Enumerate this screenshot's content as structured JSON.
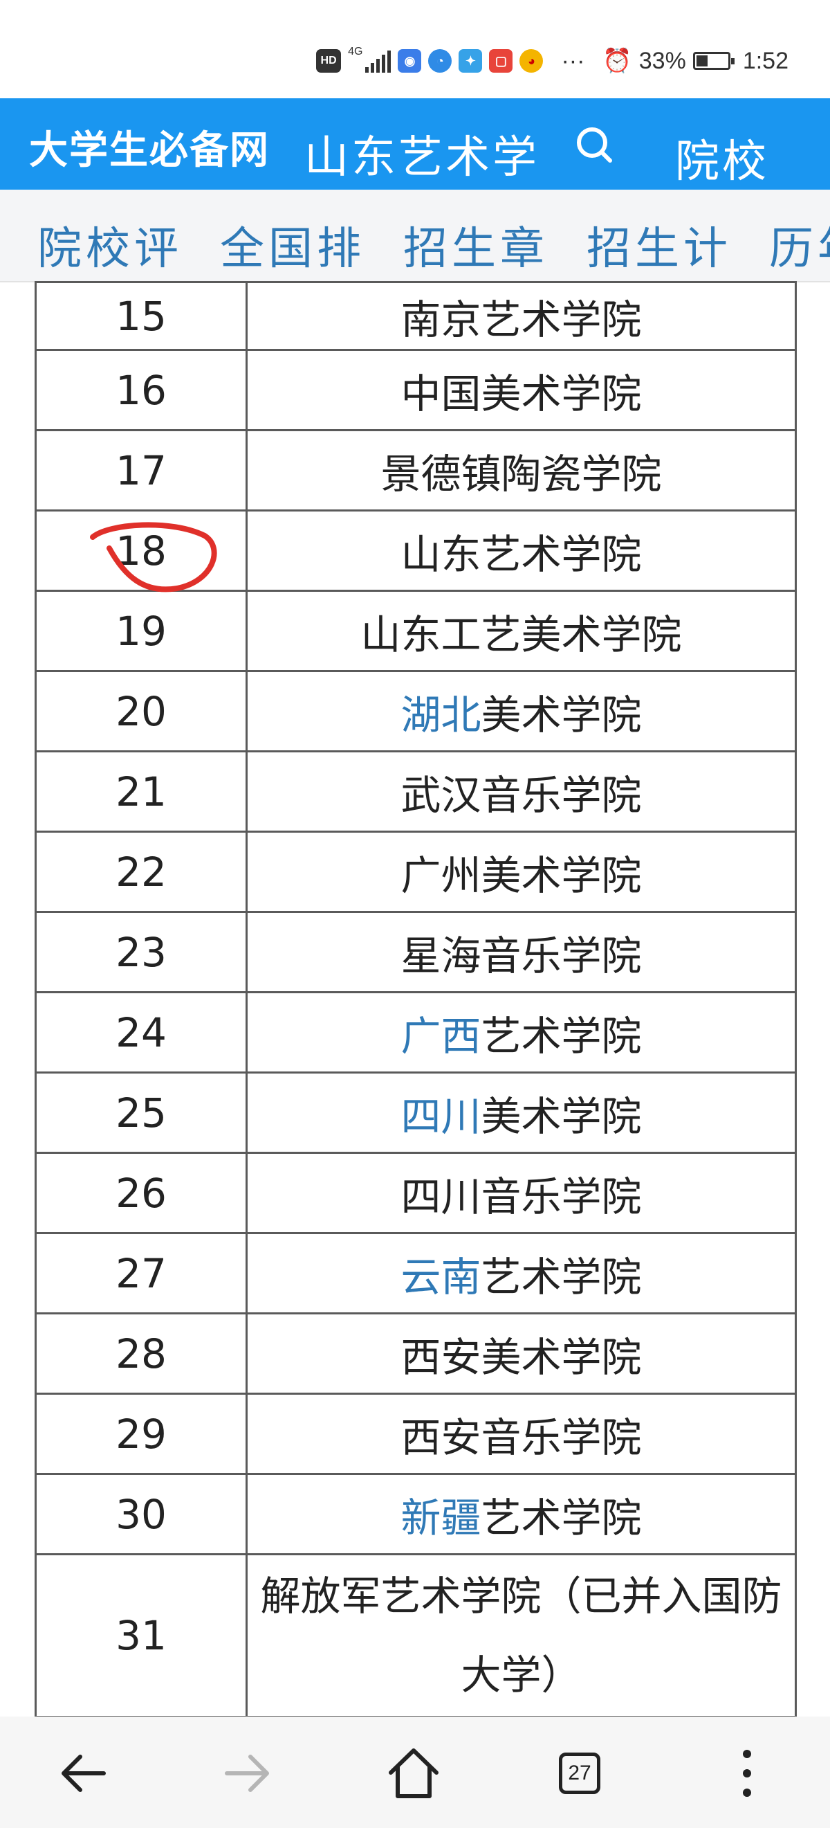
{
  "status_bar": {
    "hd": "HD",
    "network": "4G",
    "icons": [
      "wifi-icon",
      "browser-icon",
      "app-icon",
      "notes-icon",
      "weibo-icon"
    ],
    "more": "···",
    "alarm_icon": "alarm-icon",
    "battery_percent": "33%",
    "time": "1:52"
  },
  "header": {
    "logo": "大学生必备网",
    "title": "山东艺术学",
    "search_icon": "search-icon",
    "right_label": "院校"
  },
  "tabs": [
    {
      "label": "院校评"
    },
    {
      "label": "全国排"
    },
    {
      "label": "招生章"
    },
    {
      "label": "招生计"
    },
    {
      "label": "历年"
    }
  ],
  "table": {
    "rows": [
      {
        "rank": "15",
        "prefix": "",
        "name": "南京艺术学院"
      },
      {
        "rank": "16",
        "prefix": "",
        "name": "中国美术学院"
      },
      {
        "rank": "17",
        "prefix": "",
        "name": "景德镇陶瓷学院"
      },
      {
        "rank": "18",
        "prefix": "",
        "name": "山东艺术学院"
      },
      {
        "rank": "19",
        "prefix": "",
        "name": "山东工艺美术学院"
      },
      {
        "rank": "20",
        "prefix": "湖北",
        "name": "美术学院"
      },
      {
        "rank": "21",
        "prefix": "",
        "name": "武汉音乐学院"
      },
      {
        "rank": "22",
        "prefix": "",
        "name": "广州美术学院"
      },
      {
        "rank": "23",
        "prefix": "",
        "name": "星海音乐学院"
      },
      {
        "rank": "24",
        "prefix": "广西",
        "name": "艺术学院"
      },
      {
        "rank": "25",
        "prefix": "四川",
        "name": "美术学院"
      },
      {
        "rank": "26",
        "prefix": "",
        "name": "四川音乐学院"
      },
      {
        "rank": "27",
        "prefix": "云南",
        "name": "艺术学院"
      },
      {
        "rank": "28",
        "prefix": "",
        "name": "西安美术学院"
      },
      {
        "rank": "29",
        "prefix": "",
        "name": "西安音乐学院"
      },
      {
        "rank": "30",
        "prefix": "新疆",
        "name": "艺术学院"
      },
      {
        "rank": "31",
        "prefix": "",
        "name": "解放军艺术学院（已并入国防大学）"
      }
    ],
    "annotation_color": "#e0302a",
    "link_color": "#2f79b6"
  },
  "nav": {
    "back_icon": "back-arrow-icon",
    "forward_icon": "forward-arrow-icon",
    "home_icon": "home-icon",
    "tabs_count": "27",
    "menu_icon": "more-vertical-icon"
  }
}
